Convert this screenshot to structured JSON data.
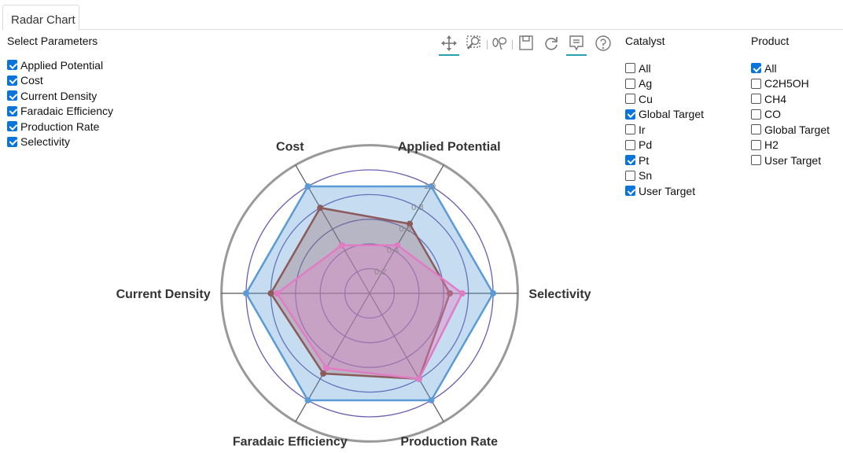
{
  "tab": {
    "label": "Radar Chart"
  },
  "parameters": {
    "title": "Select Parameters",
    "items": [
      {
        "label": "Applied Potential",
        "checked": true
      },
      {
        "label": "Cost",
        "checked": true
      },
      {
        "label": "Current Density",
        "checked": true
      },
      {
        "label": "Faradaic Efficiency",
        "checked": true
      },
      {
        "label": "Production Rate",
        "checked": true
      },
      {
        "label": "Selectivity",
        "checked": true
      }
    ]
  },
  "toolbar": {
    "icons": [
      "pan-icon",
      "zoom-icon",
      "lasso-icon",
      "save-icon",
      "reset-icon",
      "comment-icon",
      "help-icon"
    ]
  },
  "catalyst": {
    "title": "Catalyst",
    "items": [
      {
        "label": "All",
        "checked": false
      },
      {
        "label": "Ag",
        "checked": false
      },
      {
        "label": "Cu",
        "checked": false
      },
      {
        "label": "Global Target",
        "checked": true
      },
      {
        "label": "Ir",
        "checked": false
      },
      {
        "label": "Pd",
        "checked": false
      },
      {
        "label": "Pt",
        "checked": true
      },
      {
        "label": "Sn",
        "checked": false
      },
      {
        "label": "User Target",
        "checked": true
      }
    ]
  },
  "product": {
    "title": "Product",
    "items": [
      {
        "label": "All",
        "checked": true
      },
      {
        "label": "C2H5OH",
        "checked": false
      },
      {
        "label": "CH4",
        "checked": false
      },
      {
        "label": "CO",
        "checked": false
      },
      {
        "label": "Global Target",
        "checked": false
      },
      {
        "label": "H2",
        "checked": false
      },
      {
        "label": "User Target",
        "checked": false
      }
    ]
  },
  "chart_data": {
    "type": "radar",
    "axes": [
      "Applied Potential",
      "Selectivity",
      "Production Rate",
      "Faradaic Efficiency",
      "Current Density",
      "Cost"
    ],
    "radial_ticks": [
      "0.2",
      "0.4",
      "0.6",
      "0.8",
      "1.0"
    ],
    "rmax": 1.2,
    "grid": true,
    "series": [
      {
        "values": [
          1.0,
          1.0,
          1.0,
          1.0,
          1.0,
          1.0
        ],
        "color": "#5b9bd5",
        "fill": "rgba(91,155,213,0.35)"
      },
      {
        "values": [
          0.65,
          0.65,
          0.8,
          0.75,
          0.8,
          0.8
        ],
        "color": "#8c5a5a",
        "fill": "rgba(150,95,95,0.30)"
      },
      {
        "values": [
          0.45,
          0.75,
          0.8,
          0.7,
          0.75,
          0.45
        ],
        "color": "#e07cc3",
        "fill": "rgba(230,130,200,0.38)"
      }
    ]
  }
}
